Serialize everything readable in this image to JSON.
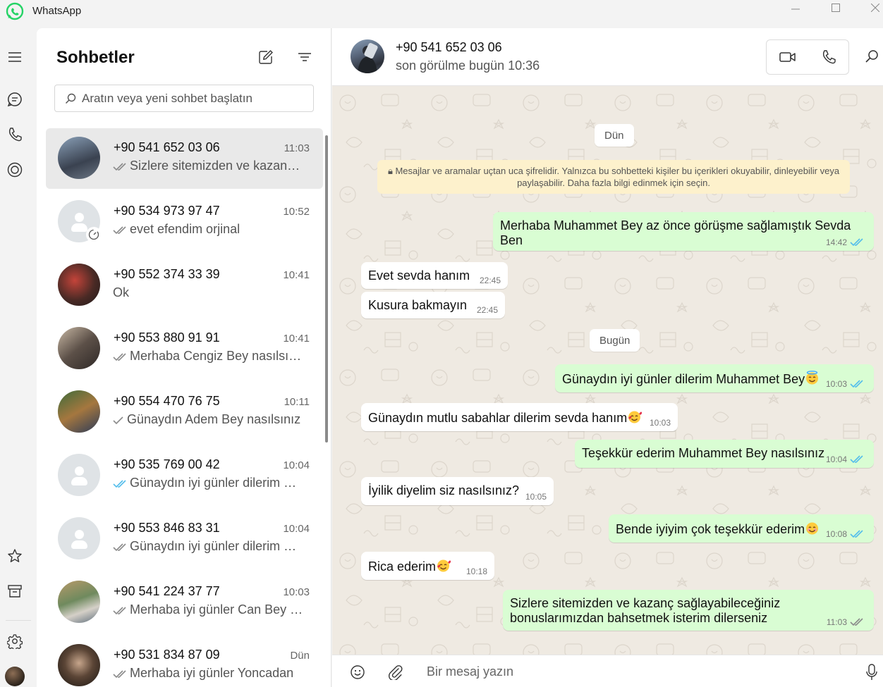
{
  "app": {
    "title": "WhatsApp"
  },
  "colors": {
    "accent": "#25d366",
    "outgoing_bubble": "#d9fdd3",
    "read_tick": "#53bdeb",
    "wallpaper": "#efeae2",
    "notice": "#fdf1cc"
  },
  "rail": {
    "icons": [
      "menu-icon",
      "chats-icon",
      "calls-icon",
      "status-icon",
      "starred-icon",
      "archive-icon",
      "settings-icon"
    ]
  },
  "list": {
    "title": "Sohbetler",
    "search_placeholder": "Aratın veya yeni sohbet başlatın",
    "chats": [
      {
        "name": "+90 541 652 03 06",
        "time": "11:03",
        "preview": "Sizlere sitemizden ve kazanç sağlayabileceğiniz bonuslarımızdan",
        "tick": "double-grey",
        "avatar": "photo"
      },
      {
        "name": "+90 534 973 97 47",
        "time": "10:52",
        "preview": "evet efendim orjinal",
        "tick": "double-grey",
        "avatar": "placeholder"
      },
      {
        "name": "+90 552 374 33 39",
        "time": "10:41",
        "preview": "Ok",
        "tick": "none",
        "avatar": "photo"
      },
      {
        "name": "+90 553 880 91 91",
        "time": "10:41",
        "preview": "Merhaba Cengiz Bey nasılsınız",
        "tick": "double-grey",
        "avatar": "photo"
      },
      {
        "name": "+90 554 470 76 75",
        "time": "10:11",
        "preview": "Günaydın Adem Bey nasılsınız",
        "tick": "single-grey",
        "avatar": "photo"
      },
      {
        "name": "+90 535 769 00 42",
        "time": "10:04",
        "preview": "Günaydın iyi günler dilerim Muhammet Bey",
        "tick": "double-blue",
        "avatar": "placeholder"
      },
      {
        "name": "+90 553 846 83 31",
        "time": "10:04",
        "preview": "Günaydın iyi günler dilerim Muhammet Bey",
        "tick": "double-grey",
        "avatar": "placeholder"
      },
      {
        "name": "+90 541 224 37 77",
        "time": "10:03",
        "preview": "Merhaba iyi günler Can Bey nasılsınız",
        "tick": "double-grey",
        "avatar": "photo"
      },
      {
        "name": "+90 531 834 87 09",
        "time": "Dün",
        "preview": "Merhaba iyi günler Yoncadan",
        "tick": "double-grey",
        "avatar": "photo"
      }
    ]
  },
  "conversation": {
    "name": "+90 541 652 03 06",
    "status": "son görülme bugün 10:36",
    "date_yesterday": "Dün",
    "date_today": "Bugün",
    "encryption_notice": "Mesajlar ve aramalar uçtan uca şifrelidir. Yalnızca bu sohbetteki kişiler bu içerikleri okuyabilir, dinleyebilir veya paylaşabilir. Daha fazla bilgi edinmek için seçin.",
    "messages": [
      {
        "dir": "out",
        "text": "Merhaba Muhammet Bey az önce görüşme sağlamıştık Sevda Ben",
        "time": "14:42",
        "tick": "double-blue"
      },
      {
        "dir": "in",
        "text": "Evet sevda hanım",
        "time": "22:45"
      },
      {
        "dir": "in",
        "text": "Kusura bakmayın",
        "time": "22:45"
      },
      {
        "dir": "out",
        "text": "Günaydın iyi günler dilerim Muhammet Bey",
        "emoji": "smiling-face-with-halo",
        "time": "10:03",
        "tick": "double-blue"
      },
      {
        "dir": "in",
        "text": "Günaydın mutlu sabahlar dilerim sevda hanım",
        "emoji": "smiling-face-with-hearts",
        "time": "10:03"
      },
      {
        "dir": "out",
        "text": "Teşekkür ederim Muhammet Bey nasılsınız",
        "time": "10:04",
        "tick": "double-blue"
      },
      {
        "dir": "in",
        "text": "İyilik diyelim siz nasılsınız?",
        "time": "10:05"
      },
      {
        "dir": "out",
        "text": "Bende iyiyim çok teşekkür ederim",
        "emoji": "smiling-face",
        "time": "10:08",
        "tick": "double-blue"
      },
      {
        "dir": "in",
        "text": "Rica ederim",
        "emoji": "smiling-face-with-hearts",
        "time": "10:18"
      },
      {
        "dir": "out",
        "text": "Sizlere sitemizden ve kazanç sağlayabileceğiniz bonuslarımızdan bahsetmek isterim dilerseniz",
        "time": "11:03",
        "tick": "double-grey"
      }
    ]
  },
  "composer": {
    "placeholder": "Bir mesaj yazın"
  }
}
